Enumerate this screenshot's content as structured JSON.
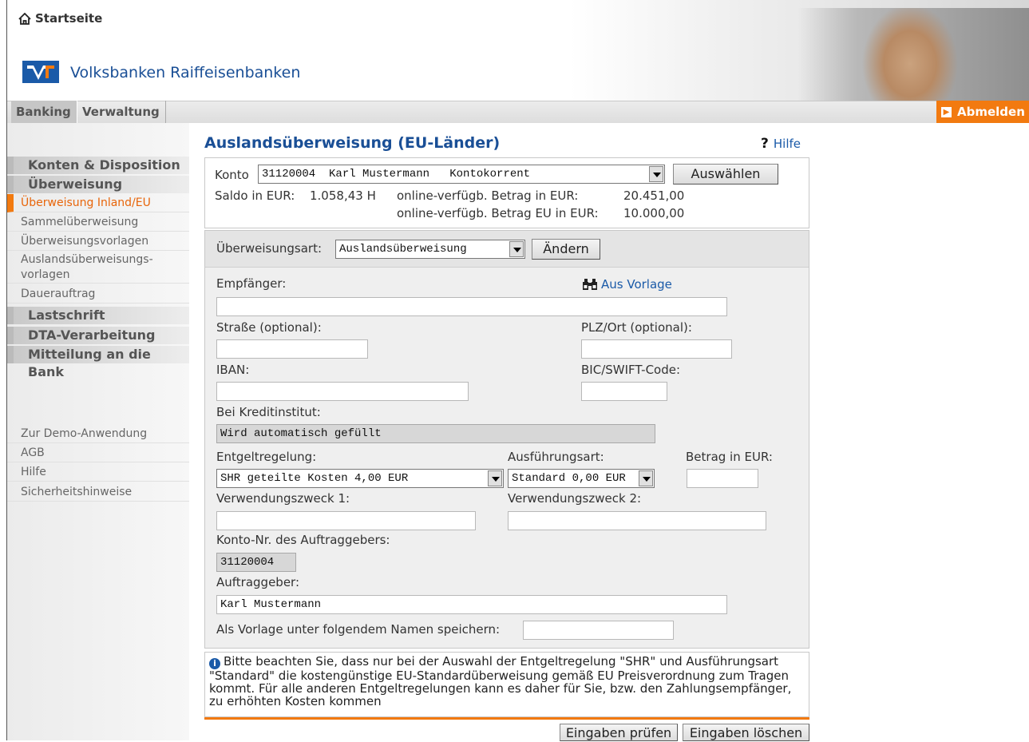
{
  "header": {
    "home_label": "Startseite",
    "bank_name": "Volksbanken Raiffeisenbanken",
    "logout_label": "Abmelden"
  },
  "nav": {
    "tabs": [
      {
        "label": "Banking"
      },
      {
        "label": "Verwaltung"
      }
    ]
  },
  "sidebar": {
    "sections": [
      {
        "label": "Konten & Disposition"
      },
      {
        "label": "Überweisung"
      }
    ],
    "items": [
      {
        "label": "Überweisung Inland/EU"
      },
      {
        "label": "Sammelüberweisung"
      },
      {
        "label": "Überweisungsvorlagen"
      },
      {
        "label": "Auslandsüberweisungs-"
      },
      {
        "label": "vorlagen"
      },
      {
        "label": "Dauerauftrag"
      }
    ],
    "more_sections": [
      {
        "label": "Lastschrift"
      },
      {
        "label": "DTA-Verarbeitung"
      },
      {
        "label": "Mitteilung an die Bank"
      }
    ],
    "footer_links": [
      {
        "label": "Zur Demo-Anwendung"
      },
      {
        "label": "AGB"
      },
      {
        "label": "Hilfe"
      },
      {
        "label": "Sicherheitshinweise"
      }
    ]
  },
  "page": {
    "title": "Auslandsüberweisung (EU-Länder)",
    "help_label": "Hilfe"
  },
  "account": {
    "konto_label": "Konto",
    "konto_value": "31120004  Karl Mustermann   Kontokorrent",
    "select_button": "Auswählen",
    "saldo_label": "Saldo in EUR:",
    "saldo_value": "1.058,43 H",
    "available_label": "online-verfügb. Betrag in EUR:",
    "available_value": "20.451,00",
    "available_eu_label": "online-verfügb. Betrag EU in EUR:",
    "available_eu_value": "10.000,00"
  },
  "form": {
    "type_label": "Überweisungsart:",
    "type_value": "Auslandsüberweisung",
    "change_button": "Ändern",
    "recipient_label": "Empfänger:",
    "from_template_label": "Aus Vorlage",
    "street_label": "Straße (optional):",
    "city_label": "PLZ/Ort (optional):",
    "iban_label": "IBAN:",
    "bic_label": "BIC/SWIFT-Code:",
    "bank_label": "Bei Kreditinstitut:",
    "bank_value": "Wird automatisch gefüllt",
    "fee_label": "Entgeltregelung:",
    "fee_value": "SHR geteilte Kosten 4,00 EUR",
    "exec_label": "Ausführungsart:",
    "exec_value": "Standard 0,00 EUR",
    "amount_label": "Betrag in EUR:",
    "purpose1_label": "Verwendungszweck 1:",
    "purpose2_label": "Verwendungszweck 2:",
    "payer_account_label": "Konto-Nr. des Auftraggebers:",
    "payer_account_value": "31120004",
    "payer_label": "Auftraggeber:",
    "payer_value": "Karl Mustermann",
    "save_template_label": "Als Vorlage unter folgendem Namen speichern:"
  },
  "notice": {
    "text": "Bitte beachten Sie, dass nur bei der Auswahl der Entgeltregelung \"SHR\" und Ausführungsart \"Standard\" die kostengünstige EU-Standardüberweisung gemäß EU Preisverordnung zum Tragen kommt. Für alle anderen Entgeltregelungen kann es daher für Sie, bzw. den Zahlungsempfänger, zu erhöhten Kosten kommen"
  },
  "actions": {
    "check_button": "Eingaben prüfen",
    "clear_button": "Eingaben löschen"
  },
  "colors": {
    "brand_blue": "#1a4f96",
    "accent_orange": "#f27a10"
  }
}
